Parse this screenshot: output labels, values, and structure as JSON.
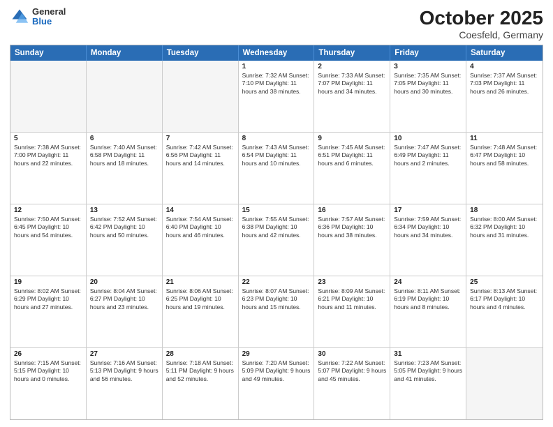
{
  "header": {
    "logo": {
      "general": "General",
      "blue": "Blue"
    },
    "title": "October 2025",
    "location": "Coesfeld, Germany"
  },
  "weekdays": [
    "Sunday",
    "Monday",
    "Tuesday",
    "Wednesday",
    "Thursday",
    "Friday",
    "Saturday"
  ],
  "rows": [
    [
      {
        "day": "",
        "info": "",
        "empty": true
      },
      {
        "day": "",
        "info": "",
        "empty": true
      },
      {
        "day": "",
        "info": "",
        "empty": true
      },
      {
        "day": "1",
        "info": "Sunrise: 7:32 AM\nSunset: 7:10 PM\nDaylight: 11 hours\nand 38 minutes.",
        "empty": false
      },
      {
        "day": "2",
        "info": "Sunrise: 7:33 AM\nSunset: 7:07 PM\nDaylight: 11 hours\nand 34 minutes.",
        "empty": false
      },
      {
        "day": "3",
        "info": "Sunrise: 7:35 AM\nSunset: 7:05 PM\nDaylight: 11 hours\nand 30 minutes.",
        "empty": false
      },
      {
        "day": "4",
        "info": "Sunrise: 7:37 AM\nSunset: 7:03 PM\nDaylight: 11 hours\nand 26 minutes.",
        "empty": false
      }
    ],
    [
      {
        "day": "5",
        "info": "Sunrise: 7:38 AM\nSunset: 7:00 PM\nDaylight: 11 hours\nand 22 minutes.",
        "empty": false
      },
      {
        "day": "6",
        "info": "Sunrise: 7:40 AM\nSunset: 6:58 PM\nDaylight: 11 hours\nand 18 minutes.",
        "empty": false
      },
      {
        "day": "7",
        "info": "Sunrise: 7:42 AM\nSunset: 6:56 PM\nDaylight: 11 hours\nand 14 minutes.",
        "empty": false
      },
      {
        "day": "8",
        "info": "Sunrise: 7:43 AM\nSunset: 6:54 PM\nDaylight: 11 hours\nand 10 minutes.",
        "empty": false
      },
      {
        "day": "9",
        "info": "Sunrise: 7:45 AM\nSunset: 6:51 PM\nDaylight: 11 hours\nand 6 minutes.",
        "empty": false
      },
      {
        "day": "10",
        "info": "Sunrise: 7:47 AM\nSunset: 6:49 PM\nDaylight: 11 hours\nand 2 minutes.",
        "empty": false
      },
      {
        "day": "11",
        "info": "Sunrise: 7:48 AM\nSunset: 6:47 PM\nDaylight: 10 hours\nand 58 minutes.",
        "empty": false
      }
    ],
    [
      {
        "day": "12",
        "info": "Sunrise: 7:50 AM\nSunset: 6:45 PM\nDaylight: 10 hours\nand 54 minutes.",
        "empty": false
      },
      {
        "day": "13",
        "info": "Sunrise: 7:52 AM\nSunset: 6:42 PM\nDaylight: 10 hours\nand 50 minutes.",
        "empty": false
      },
      {
        "day": "14",
        "info": "Sunrise: 7:54 AM\nSunset: 6:40 PM\nDaylight: 10 hours\nand 46 minutes.",
        "empty": false
      },
      {
        "day": "15",
        "info": "Sunrise: 7:55 AM\nSunset: 6:38 PM\nDaylight: 10 hours\nand 42 minutes.",
        "empty": false
      },
      {
        "day": "16",
        "info": "Sunrise: 7:57 AM\nSunset: 6:36 PM\nDaylight: 10 hours\nand 38 minutes.",
        "empty": false
      },
      {
        "day": "17",
        "info": "Sunrise: 7:59 AM\nSunset: 6:34 PM\nDaylight: 10 hours\nand 34 minutes.",
        "empty": false
      },
      {
        "day": "18",
        "info": "Sunrise: 8:00 AM\nSunset: 6:32 PM\nDaylight: 10 hours\nand 31 minutes.",
        "empty": false
      }
    ],
    [
      {
        "day": "19",
        "info": "Sunrise: 8:02 AM\nSunset: 6:29 PM\nDaylight: 10 hours\nand 27 minutes.",
        "empty": false
      },
      {
        "day": "20",
        "info": "Sunrise: 8:04 AM\nSunset: 6:27 PM\nDaylight: 10 hours\nand 23 minutes.",
        "empty": false
      },
      {
        "day": "21",
        "info": "Sunrise: 8:06 AM\nSunset: 6:25 PM\nDaylight: 10 hours\nand 19 minutes.",
        "empty": false
      },
      {
        "day": "22",
        "info": "Sunrise: 8:07 AM\nSunset: 6:23 PM\nDaylight: 10 hours\nand 15 minutes.",
        "empty": false
      },
      {
        "day": "23",
        "info": "Sunrise: 8:09 AM\nSunset: 6:21 PM\nDaylight: 10 hours\nand 11 minutes.",
        "empty": false
      },
      {
        "day": "24",
        "info": "Sunrise: 8:11 AM\nSunset: 6:19 PM\nDaylight: 10 hours\nand 8 minutes.",
        "empty": false
      },
      {
        "day": "25",
        "info": "Sunrise: 8:13 AM\nSunset: 6:17 PM\nDaylight: 10 hours\nand 4 minutes.",
        "empty": false
      }
    ],
    [
      {
        "day": "26",
        "info": "Sunrise: 7:15 AM\nSunset: 5:15 PM\nDaylight: 10 hours\nand 0 minutes.",
        "empty": false
      },
      {
        "day": "27",
        "info": "Sunrise: 7:16 AM\nSunset: 5:13 PM\nDaylight: 9 hours\nand 56 minutes.",
        "empty": false
      },
      {
        "day": "28",
        "info": "Sunrise: 7:18 AM\nSunset: 5:11 PM\nDaylight: 9 hours\nand 52 minutes.",
        "empty": false
      },
      {
        "day": "29",
        "info": "Sunrise: 7:20 AM\nSunset: 5:09 PM\nDaylight: 9 hours\nand 49 minutes.",
        "empty": false
      },
      {
        "day": "30",
        "info": "Sunrise: 7:22 AM\nSunset: 5:07 PM\nDaylight: 9 hours\nand 45 minutes.",
        "empty": false
      },
      {
        "day": "31",
        "info": "Sunrise: 7:23 AM\nSunset: 5:05 PM\nDaylight: 9 hours\nand 41 minutes.",
        "empty": false
      },
      {
        "day": "",
        "info": "",
        "empty": true
      }
    ]
  ]
}
